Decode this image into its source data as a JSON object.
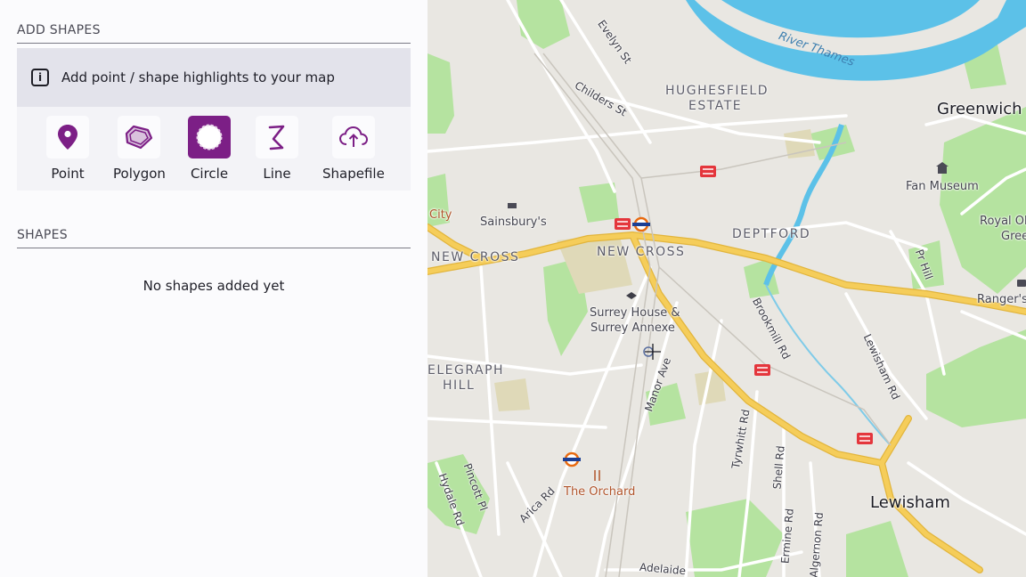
{
  "sidebar": {
    "add_shapes_heading": "ADD SHAPES",
    "info_text": "Add point / shape highlights to your map",
    "tools": [
      {
        "label": "Point",
        "icon": "pin-icon",
        "active": false
      },
      {
        "label": "Polygon",
        "icon": "polygon-icon",
        "active": false
      },
      {
        "label": "Circle",
        "icon": "circle-icon",
        "active": true
      },
      {
        "label": "Line",
        "icon": "line-icon",
        "active": false
      },
      {
        "label": "Shapefile",
        "icon": "cloud-upload-icon",
        "active": false
      }
    ],
    "shapes_heading": "SHAPES",
    "empty_text": "No shapes added yet"
  },
  "map": {
    "colors": {
      "water": "#5cc1e8",
      "park": "#b5e3a0",
      "major_road": "#f5cd5a",
      "land": "#e9e7e2",
      "accent": "#7c1f86"
    },
    "labels": {
      "greenwich": "Greenwich",
      "river_thames": "River Thames",
      "hughesfield_estate_1": "HUGHESFIELD",
      "hughesfield_estate_2": "ESTATE",
      "evelyn_st": "Evelyn St",
      "childers_st": "Childers St",
      "fan_museum": "Fan Museum",
      "royal_obs_1": "Royal Ob",
      "royal_obs_2": "Gree",
      "city": "City",
      "sainsburys": "Sainsbury's",
      "deptford": "DEPTFORD",
      "new_cross_west": "NEW CROSS",
      "new_cross": "NEW CROSS",
      "pr_hill": "Pr Hill",
      "rangers": "Ranger's",
      "surrey_house_1": "Surrey House &",
      "surrey_house_2": "Surrey Annexe",
      "brookmill_rd": "Brookmill Rd",
      "lewisham_rd": "Lewisham Rd",
      "telegraph_hill_1": "ELEGRAPH",
      "telegraph_hill_2": "HILL",
      "manor_ave": "Manor Ave",
      "tyrwhitt_rd": "Tyrwhitt Rd",
      "shell_rd": "Shell Rd",
      "lewisham": "Lewisham",
      "pincott_pl": "Pincott Pl",
      "hydale_rd": "Hydale Rd",
      "arica_rd": "Arica Rd",
      "the_orchard": "The Orchard",
      "ermine_rd": "Ermine Rd",
      "algernon_rd": "Algernon Rd",
      "adelaide": "Adelaide"
    }
  }
}
